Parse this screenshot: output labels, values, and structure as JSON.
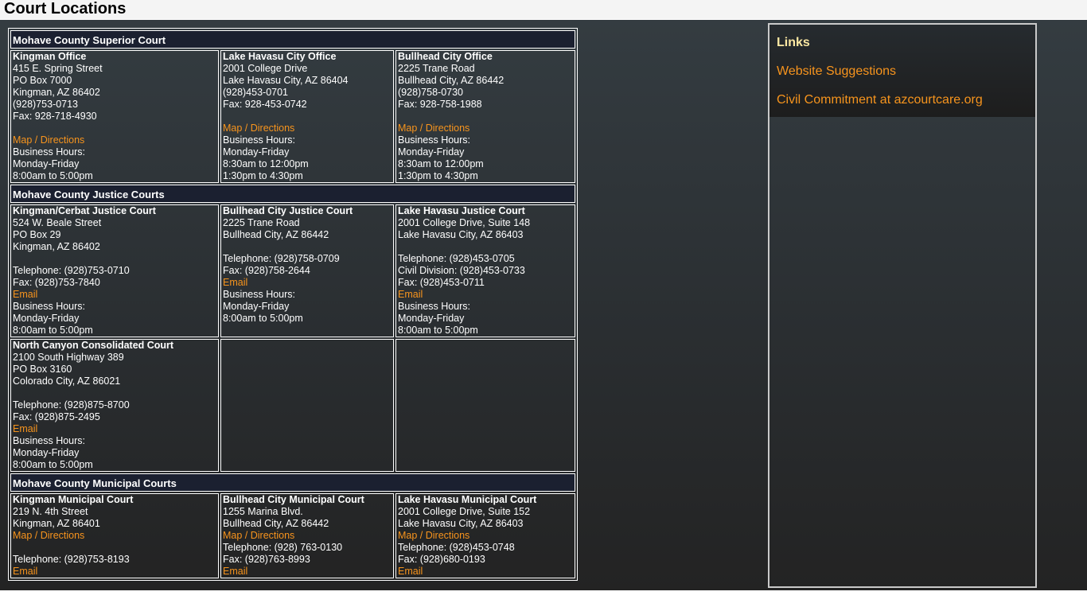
{
  "page": {
    "title": "Court Locations"
  },
  "sections": [
    {
      "header": "Mohave County Superior Court",
      "rows": [
        [
          {
            "name": "Kingman Office",
            "lines": [
              "415 E. Spring Street",
              "PO Box 7000",
              "Kingman, AZ 86402",
              "(928)753-0713",
              "Fax: 928-718-4930",
              "",
              {
                "link": "Map / Directions"
              },
              "Business Hours:",
              "Monday-Friday",
              "8:00am to 5:00pm"
            ]
          },
          {
            "name": "Lake Havasu City Office",
            "lines": [
              "2001 College Drive",
              "Lake Havasu City, AZ 86404",
              "(928)453-0701",
              "Fax: 928-453-0742",
              "",
              {
                "link": "Map / Directions"
              },
              "Business Hours:",
              "Monday-Friday",
              "8:30am to 12:00pm",
              "1:30pm to 4:30pm"
            ]
          },
          {
            "name": "Bullhead City Office",
            "lines": [
              "2225 Trane Road",
              "Bullhead City, AZ 86442",
              "(928)758-0730",
              "Fax: 928-758-1988",
              "",
              {
                "link": "Map / Directions"
              },
              "Business Hours:",
              "Monday-Friday",
              "8:30am to 12:00pm",
              "1:30pm to 4:30pm"
            ]
          }
        ]
      ]
    },
    {
      "header": "Mohave County Justice Courts",
      "rows": [
        [
          {
            "name": "Kingman/Cerbat Justice Court",
            "lines": [
              "524 W. Beale Street",
              "PO Box 29",
              "Kingman, AZ 86402",
              "",
              "Telephone: (928)753-0710",
              "Fax: (928)753-7840",
              {
                "link": "Email"
              },
              "Business Hours:",
              "Monday-Friday",
              "8:00am to 5:00pm"
            ]
          },
          {
            "name": "Bullhead City Justice Court",
            "lines": [
              "2225 Trane Road",
              "Bullhead City, AZ 86442",
              "",
              "Telephone: (928)758-0709",
              "Fax: (928)758-2644",
              {
                "link": "Email"
              },
              "Business Hours:",
              "Monday-Friday",
              "8:00am to 5:00pm"
            ]
          },
          {
            "name": "Lake Havasu Justice Court",
            "lines": [
              "2001 College Drive, Suite 148",
              "Lake Havasu City, AZ 86403",
              "",
              "Telephone: (928)453-0705",
              "Civil Division: (928)453-0733",
              "Fax: (928)453-0711",
              {
                "link": "Email"
              },
              "Business Hours:",
              "Monday-Friday",
              "8:00am to 5:00pm"
            ]
          }
        ],
        [
          {
            "name": "North Canyon Consolidated Court",
            "lines": [
              "2100 South Highway 389",
              "PO Box 3160",
              "Colorado City, AZ 86021",
              "",
              "Telephone: (928)875-8700",
              "Fax: (928)875-2495",
              {
                "link": "Email"
              },
              "Business Hours:",
              "Monday-Friday",
              "8:00am to 5:00pm"
            ]
          },
          null,
          null
        ]
      ]
    },
    {
      "header": "Mohave County Municipal Courts",
      "rows": [
        [
          {
            "name": "Kingman Municipal Court",
            "lines": [
              "219 N. 4th Street",
              "Kingman, AZ 86401",
              {
                "link": "Map / Directions"
              },
              "",
              "Telephone: (928)753-8193",
              {
                "link": "Email"
              }
            ]
          },
          {
            "name": "Bullhead City Municipal Court",
            "lines": [
              "1255 Marina Blvd.",
              "Bullhead City, AZ 86442",
              {
                "link": "Map / Directions"
              },
              "Telephone: (928) 763-0130",
              "Fax: (928)763-8993",
              {
                "link": "Email"
              }
            ]
          },
          {
            "name": "Lake Havasu Municipal Court",
            "lines": [
              "2001 College Drive, Suite 152",
              "Lake Havasu City, AZ 86403",
              {
                "link": "Map / Directions"
              },
              "Telephone: (928)453-0748",
              "Fax: (928)680-0193",
              {
                "link": "Email"
              }
            ]
          }
        ]
      ]
    }
  ],
  "links_panel": {
    "title": "Links",
    "items": [
      "Website Suggestions",
      "Civil Commitment at azcourtcare.org"
    ]
  },
  "colors": {
    "link": "#f7941d",
    "links_title": "#fde9a3",
    "header_bg": "#1b2030"
  }
}
